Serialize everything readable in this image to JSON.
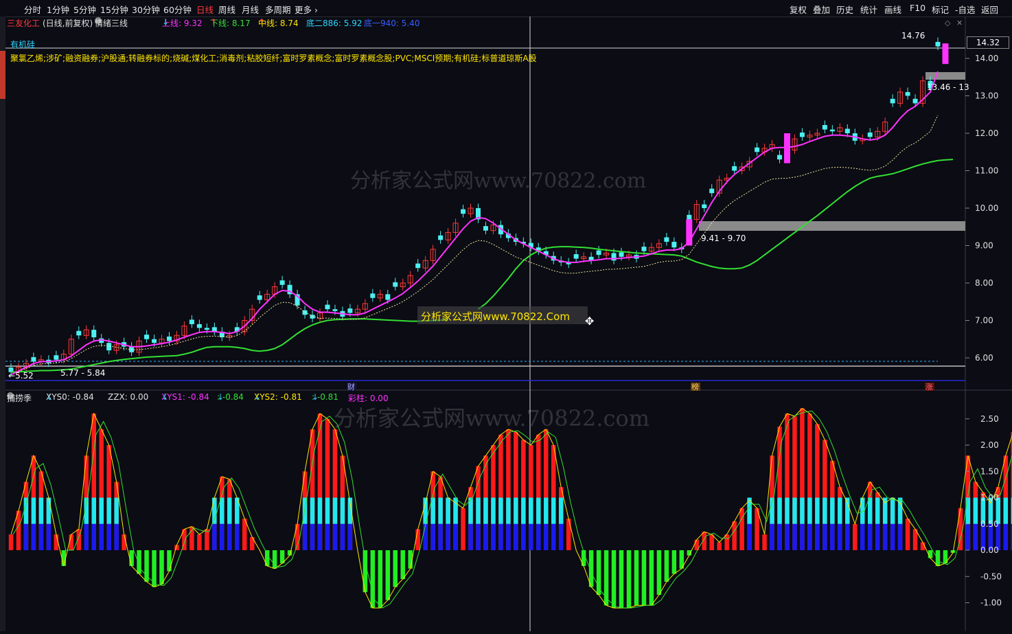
{
  "toolbar": {
    "left": [
      "分时",
      "1分钟",
      "5分钟",
      "15分钟",
      "30分钟",
      "60分钟",
      "日线",
      "周线",
      "月线",
      "多周期",
      "更多"
    ],
    "active": "日线",
    "right": [
      "复权",
      "叠加",
      "历史",
      "统计",
      "画线",
      "F10",
      "标记",
      "-自选",
      "返回"
    ]
  },
  "main_info": {
    "stock": "三友化工",
    "mode": "(日线,前复权)",
    "indicator": "情绪三线",
    "upper_label": "上线: 9.32",
    "lower_label": "下线: 8.17",
    "mid_label": "中线: 8.74",
    "bottom2_label": "底二886: 5.92",
    "bottom3_label": "底一940: 5.40"
  },
  "concept_tag": "有机硅",
  "concepts": "聚氯乙烯;涉矿;融资融券;沪股通;转融券标的;烧碱;煤化工;消毒剂;粘胶短纤;富时罗素概念;富时罗素概念股;PVC;MSCI预期;有机硅;标普道琼斯A股",
  "price_axis": [
    "14.00",
    "13.00",
    "12.00",
    "11.00",
    "10.00",
    "9.00",
    "8.00",
    "7.00",
    "6.00"
  ],
  "last_price": "14.32",
  "annotations": {
    "high": "14.76",
    "low": "5.52",
    "zone_low": "5.77 - 5.84",
    "zone_mid": "9.41 - 9.70",
    "zone_high": "13.46 - 13"
  },
  "event_markers": [
    "财",
    "榜",
    "涨"
  ],
  "watermark": "分析家公式网www.70822.com",
  "popup": "分析家公式网www.70822.Com",
  "sub_info": {
    "name": "捕捞季",
    "xys0": "XYS0: -0.84",
    "zzx": "ZZX: 0.00",
    "xys1": "XYS1: -0.84",
    "xys1b": ": -0.84",
    "xys2": "XYS2: -0.81",
    "xys2b": ": -0.81",
    "caizhu": "彩柱: 0.00"
  },
  "sub_axis": [
    "2.50",
    "2.00",
    "1.50",
    "1.00",
    "0.50",
    "0.00",
    "-0.50",
    "-1.00"
  ],
  "colors": {
    "up": "#ff3b3b",
    "down": "#4df0f0",
    "ma_fast": "#ff33ff",
    "ma_slow": "#33e033",
    "bar_red": "#ff1a1a",
    "bar_green": "#22ee22",
    "bar_cyan": "#22e8ee",
    "bar_blue": "#1a1aee"
  },
  "chart_data": {
    "type": "candlestick",
    "close": [
      5.62,
      5.75,
      5.85,
      5.9,
      5.95,
      5.86,
      5.95,
      6.1,
      6.5,
      6.6,
      6.75,
      6.55,
      6.4,
      6.2,
      6.35,
      6.3,
      6.15,
      6.45,
      6.5,
      6.4,
      6.5,
      6.45,
      6.6,
      6.85,
      6.9,
      6.8,
      6.75,
      6.7,
      6.55,
      6.6,
      6.7,
      7.0,
      7.3,
      7.55,
      7.7,
      7.9,
      7.95,
      7.7,
      7.4,
      7.15,
      7.05,
      7.2,
      7.3,
      7.25,
      7.1,
      7.2,
      7.3,
      7.45,
      7.6,
      7.7,
      7.55,
      7.9,
      8.0,
      8.2,
      8.4,
      8.6,
      8.9,
      9.15,
      9.35,
      9.6,
      9.85,
      10.0,
      9.7,
      9.4,
      9.55,
      9.3,
      9.2,
      9.1,
      9.05,
      8.95,
      8.85,
      8.75,
      8.6,
      8.55,
      8.5,
      8.65,
      8.7,
      8.6,
      8.75,
      8.8,
      8.6,
      8.7,
      8.75,
      8.65,
      8.85,
      8.95,
      9.05,
      9.1,
      8.95,
      8.9,
      9.7,
      10.1,
      10.0,
      10.4,
      10.75,
      10.8,
      11.0,
      11.1,
      11.25,
      11.5,
      11.6,
      11.7,
      11.3,
      11.55,
      11.85,
      11.9,
      11.95,
      12.0,
      12.1,
      12.05,
      12.15,
      12.0,
      11.8,
      11.85,
      11.9,
      12.05,
      12.3,
      12.8,
      13.1,
      13.0,
      12.8,
      13.4,
      13.2,
      14.32
    ],
    "ma_fast": [
      5.55,
      5.65,
      5.75,
      5.85,
      5.9,
      5.9,
      5.92,
      5.95,
      6.05,
      6.2,
      6.35,
      6.45,
      6.48,
      6.45,
      6.4,
      6.35,
      6.3,
      6.3,
      6.32,
      6.35,
      6.38,
      6.42,
      6.48,
      6.55,
      6.62,
      6.68,
      6.7,
      6.7,
      6.68,
      6.65,
      6.7,
      6.85,
      7.05,
      7.3,
      7.5,
      7.7,
      7.8,
      7.78,
      7.65,
      7.45,
      7.3,
      7.22,
      7.22,
      7.2,
      7.18,
      7.15,
      7.15,
      7.2,
      7.3,
      7.4,
      7.5,
      7.6,
      7.72,
      7.88,
      8.05,
      8.25,
      8.45,
      8.7,
      8.95,
      9.2,
      9.45,
      9.65,
      9.75,
      9.72,
      9.6,
      9.45,
      9.3,
      9.15,
      9.05,
      8.95,
      8.85,
      8.75,
      8.65,
      8.58,
      8.55,
      8.55,
      8.58,
      8.6,
      8.62,
      8.65,
      8.65,
      8.66,
      8.68,
      8.7,
      8.72,
      8.78,
      8.85,
      8.88,
      8.88,
      8.92,
      9.1,
      9.45,
      9.8,
      10.15,
      10.45,
      10.7,
      10.9,
      11.05,
      11.2,
      11.35,
      11.5,
      11.6,
      11.62,
      11.62,
      11.65,
      11.7,
      11.78,
      11.85,
      11.92,
      11.95,
      11.95,
      11.93,
      11.9,
      11.85,
      11.82,
      11.85,
      11.95,
      12.15,
      12.4,
      12.6,
      12.72,
      12.9,
      13.1,
      13.65
    ],
    "ma_slow": [
      5.62,
      5.63,
      5.64,
      5.65,
      5.66,
      5.66,
      5.67,
      5.68,
      5.7,
      5.74,
      5.78,
      5.82,
      5.86,
      5.9,
      5.93,
      5.96,
      5.98,
      6.0,
      6.02,
      6.03,
      6.04,
      6.05,
      6.06,
      6.1,
      6.15,
      6.22,
      6.28,
      6.3,
      6.3,
      6.3,
      6.28,
      6.25,
      6.2,
      6.18,
      6.2,
      6.25,
      6.35,
      6.5,
      6.65,
      6.78,
      6.88,
      6.95,
      7.0,
      7.02,
      7.03,
      7.04,
      7.04,
      7.04,
      7.03,
      7.02,
      7.01,
      7.0,
      6.99,
      6.98,
      6.98,
      6.99,
      7.0,
      7.01,
      7.02,
      null,
      null,
      null,
      7.3,
      7.45,
      7.65,
      7.88,
      8.12,
      8.38,
      8.6,
      8.75,
      8.86,
      8.93,
      8.96,
      8.97,
      8.97,
      8.96,
      8.95,
      8.93,
      8.9,
      8.88,
      8.86,
      8.84,
      8.82,
      8.8,
      8.79,
      8.78,
      8.77,
      8.76,
      8.75,
      8.72,
      8.64,
      8.56,
      8.5,
      8.44,
      8.4,
      8.38,
      8.38,
      8.4,
      8.48,
      8.6,
      8.75,
      8.9,
      9.05,
      9.2,
      9.35,
      9.5,
      9.65,
      9.8,
      9.96,
      10.12,
      10.28,
      10.44,
      10.58,
      10.7,
      10.8,
      10.85,
      10.88,
      10.92,
      10.98,
      11.05,
      11.12,
      11.18,
      11.23,
      11.27,
      11.29,
      11.3
    ],
    "sub_values": [
      0.3,
      0.75,
      1.3,
      1.8,
      1.5,
      1.0,
      0.3,
      -0.3,
      0.3,
      0.4,
      1.8,
      2.6,
      2.3,
      2.0,
      1.3,
      0.3,
      -0.3,
      -0.45,
      -0.6,
      -0.7,
      -0.65,
      -0.4,
      0.1,
      0.4,
      0.45,
      0.3,
      0.4,
      1.0,
      1.4,
      1.35,
      1.0,
      0.6,
      0.25,
      0.0,
      -0.3,
      -0.35,
      -0.25,
      -0.1,
      0.5,
      1.5,
      2.3,
      2.6,
      2.5,
      2.3,
      1.8,
      0.9,
      0.0,
      -0.8,
      -1.1,
      -1.1,
      -0.95,
      -0.7,
      -0.55,
      -0.35,
      0.4,
      0.9,
      1.5,
      1.4,
      1.0,
      0.9,
      0.8,
      1.2,
      1.6,
      1.8,
      2.0,
      2.2,
      2.3,
      2.25,
      2.1,
      2.0,
      2.2,
      2.3,
      2.0,
      1.2,
      0.6,
      0.0,
      -0.3,
      -0.7,
      -0.85,
      -1.05,
      -1.1,
      -1.1,
      -1.1,
      -1.05,
      -1.05,
      -1.05,
      -0.85,
      -0.6,
      -0.45,
      -0.35,
      -0.1,
      0.2,
      0.35,
      0.3,
      0.15,
      0.3,
      0.55,
      0.8,
      0.95,
      0.8,
      0.3,
      1.8,
      2.35,
      2.6,
      2.55,
      2.7,
      2.6,
      2.4,
      2.1,
      1.7,
      1.2,
      0.9,
      0.5,
      1.0,
      1.3,
      1.1,
      0.9,
      1.0,
      0.9,
      0.6,
      0.4,
      0.15,
      -0.15,
      -0.3,
      -0.25,
      -0.05,
      0.8,
      1.8,
      1.3,
      1.1,
      0.9,
      1.2,
      1.8,
      2.25
    ]
  }
}
